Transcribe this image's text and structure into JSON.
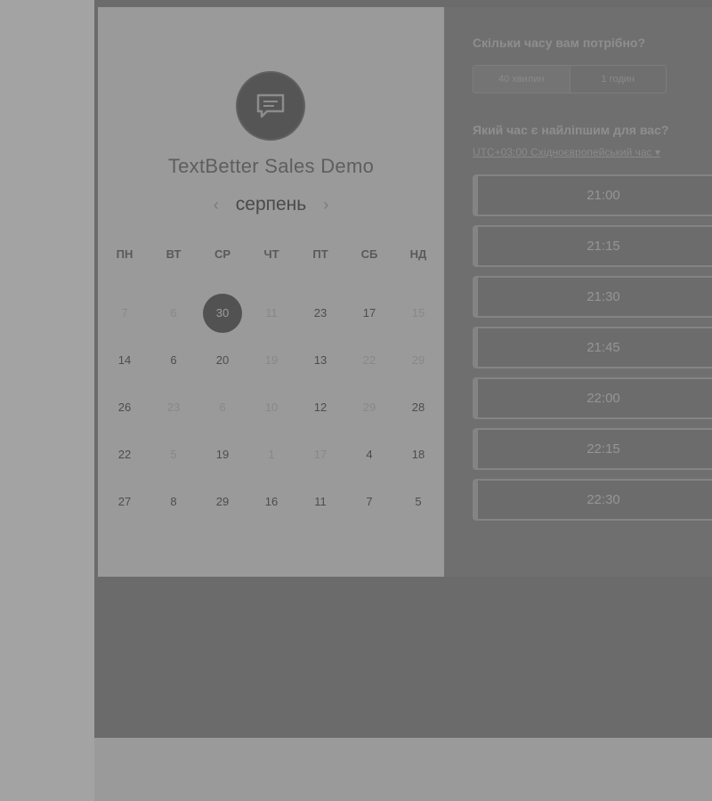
{
  "event": {
    "title": "TextBetter Sales Demo",
    "avatar_icon": "chat-bubble-icon"
  },
  "calendar": {
    "month": "серпень",
    "prev_icon": "chevron-left-icon",
    "next_icon": "chevron-right-icon",
    "weekdays": [
      "ПН",
      "ВТ",
      "СР",
      "ЧТ",
      "ПТ",
      "СБ",
      "НД"
    ],
    "weeks": [
      [
        {
          "d": "7",
          "s": "muted"
        },
        {
          "d": "6",
          "s": "muted"
        },
        {
          "d": "30",
          "s": "selected"
        },
        {
          "d": "11",
          "s": "muted"
        },
        {
          "d": "23",
          "s": "active"
        },
        {
          "d": "17",
          "s": "active"
        },
        {
          "d": "15",
          "s": "muted"
        }
      ],
      [
        {
          "d": "14",
          "s": "active"
        },
        {
          "d": "6",
          "s": "active"
        },
        {
          "d": "20",
          "s": "active"
        },
        {
          "d": "19",
          "s": "muted"
        },
        {
          "d": "13",
          "s": "active"
        },
        {
          "d": "22",
          "s": "muted"
        },
        {
          "d": "29",
          "s": "muted"
        }
      ],
      [
        {
          "d": "26",
          "s": "active"
        },
        {
          "d": "23",
          "s": "muted"
        },
        {
          "d": "6",
          "s": "muted"
        },
        {
          "d": "10",
          "s": "muted"
        },
        {
          "d": "12",
          "s": "active"
        },
        {
          "d": "29",
          "s": "muted"
        },
        {
          "d": "28",
          "s": "active"
        }
      ],
      [
        {
          "d": "22",
          "s": "active"
        },
        {
          "d": "5",
          "s": "muted"
        },
        {
          "d": "19",
          "s": "active"
        },
        {
          "d": "1",
          "s": "muted"
        },
        {
          "d": "17",
          "s": "muted"
        },
        {
          "d": "4",
          "s": "active"
        },
        {
          "d": "18",
          "s": "active"
        }
      ],
      [
        {
          "d": "27",
          "s": "active"
        },
        {
          "d": "8",
          "s": "active"
        },
        {
          "d": "29",
          "s": "active"
        },
        {
          "d": "16",
          "s": "active"
        },
        {
          "d": "11",
          "s": "active"
        },
        {
          "d": "7",
          "s": "active"
        },
        {
          "d": "5",
          "s": "active"
        }
      ]
    ]
  },
  "booking": {
    "duration_question": "Скільки часу вам потрібно?",
    "durations": [
      "40 хвилин",
      "1 годин"
    ],
    "selected_duration": "40 хвилин",
    "time_question": "Який час є найліпшим для вас?",
    "timezone": "UTC+03:00 Східноєвропейський час ▾",
    "slots": [
      "21:00",
      "21:15",
      "21:30",
      "21:45",
      "22:00",
      "22:15",
      "22:30"
    ]
  }
}
